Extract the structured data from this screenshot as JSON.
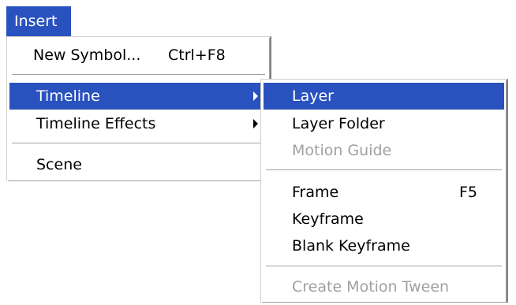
{
  "menubar": {
    "insert_label": "Insert"
  },
  "insert_menu": {
    "new_symbol_label": "New Symbol...",
    "new_symbol_shortcut": "Ctrl+F8",
    "timeline_label": "Timeline",
    "timeline_effects_label": "Timeline Effects",
    "scene_label": "Scene"
  },
  "timeline_submenu": {
    "layer_label": "Layer",
    "layer_folder_label": "Layer Folder",
    "motion_guide_label": "Motion Guide",
    "frame_label": "Frame",
    "frame_shortcut": "F5",
    "keyframe_label": "Keyframe",
    "blank_keyframe_label": "Blank Keyframe",
    "create_motion_tween_label": "Create Motion Tween"
  },
  "colors": {
    "highlight": "#2a52be",
    "disabled_text": "#a0a0a0",
    "background": "#ffffff"
  }
}
